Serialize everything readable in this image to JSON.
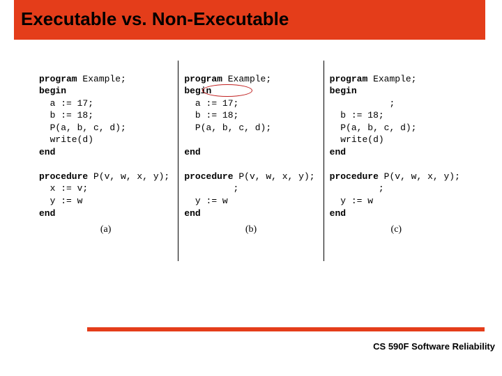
{
  "title": "Executable vs. Non-Executable",
  "columns": {
    "a": {
      "label": "(a)",
      "l1": "program",
      "l1b": " Example;",
      "l2": "begin",
      "l3": "  a := 17;",
      "l4": "  b := 18;",
      "l5": "  P(a, b, c, d);",
      "l6": "  write(d)",
      "l7": "end",
      "p1": "procedure",
      "p1b": " P(v, w, x, y);",
      "p2": "  x := v;",
      "p3": "  y := w",
      "p4": "end"
    },
    "b": {
      "label": "(b)",
      "l1": "program",
      "l1b": " Example;",
      "l2": "begin",
      "l3": "  a := 17;",
      "l4": "  b := 18;",
      "l5": "  P(a, b, c, d);",
      "l6": "",
      "l7": "end",
      "p1": "procedure",
      "p1b": " P(v, w, x, y);",
      "p2": "         ;",
      "p3": "  y := w",
      "p4": "end"
    },
    "c": {
      "label": "(c)",
      "l1": "program",
      "l1b": " Example;",
      "l2": "begin",
      "l3": "           ;",
      "l4": "  b := 18;",
      "l5": "  P(a, b, c, d);",
      "l6": "  write(d)",
      "l7": "end",
      "p1": "procedure",
      "p1b": " P(v, w, x, y);",
      "p2": "         ;",
      "p3": "  y := w",
      "p4": "end"
    }
  },
  "footer": "CS 590F Software Reliability"
}
